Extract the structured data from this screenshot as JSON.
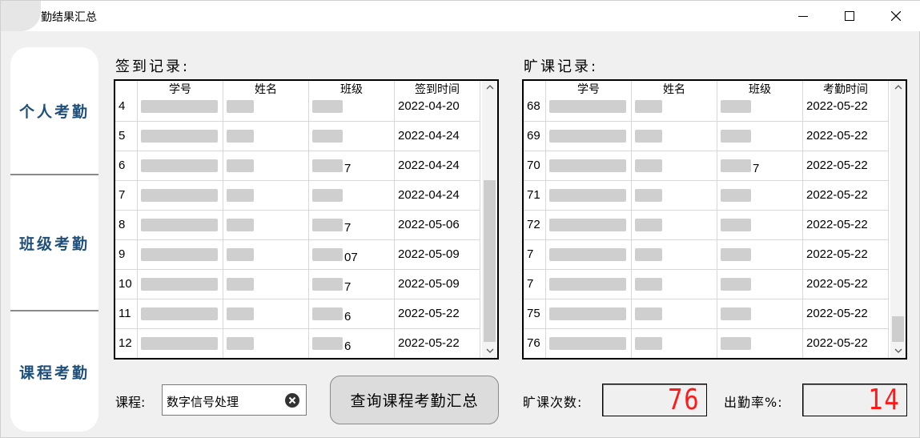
{
  "window": {
    "title": "勤结果汇总",
    "minimize_icon": "minimize-icon",
    "maximize_icon": "maximize-icon",
    "close_icon": "close-icon"
  },
  "sidebar": {
    "items": [
      {
        "label": "个人考勤"
      },
      {
        "label": "班级考勤"
      },
      {
        "label": "课程考勤"
      }
    ]
  },
  "signin": {
    "title": "签到记录:",
    "columns": [
      "学号",
      "姓名",
      "班级",
      "签到时间"
    ],
    "rows": [
      {
        "num": "4",
        "class_suffix": "",
        "date": "2022-04-20"
      },
      {
        "num": "5",
        "class_suffix": "",
        "date": "2022-04-24"
      },
      {
        "num": "6",
        "class_suffix": "7",
        "date": "2022-04-24"
      },
      {
        "num": "7",
        "class_suffix": "",
        "date": "2022-04-24"
      },
      {
        "num": "8",
        "class_suffix": "7",
        "date": "2022-05-06"
      },
      {
        "num": "9",
        "class_suffix": "07",
        "date": "2022-05-09"
      },
      {
        "num": "10",
        "class_suffix": "7",
        "date": "2022-05-09"
      },
      {
        "num": "11",
        "class_suffix": "6",
        "date": "2022-05-22"
      },
      {
        "num": "12",
        "class_suffix": "6",
        "date": "2022-05-22"
      }
    ],
    "scroll_position": 0.55
  },
  "absence": {
    "title": "旷课记录:",
    "columns": [
      "学号",
      "姓名",
      "班级",
      "考勤时间"
    ],
    "rows": [
      {
        "num": "68",
        "class_suffix": "",
        "date": "2022-05-22"
      },
      {
        "num": "69",
        "class_suffix": "",
        "date": "2022-05-22"
      },
      {
        "num": "70",
        "class_suffix": "7",
        "date": "2022-05-22"
      },
      {
        "num": "71",
        "class_suffix": "",
        "date": "2022-05-22"
      },
      {
        "num": "72",
        "class_suffix": "",
        "date": "2022-05-22"
      },
      {
        "num": "7",
        "class_suffix": "",
        "date": "2022-05-22"
      },
      {
        "num": "7",
        "class_suffix": "",
        "date": "2022-05-22"
      },
      {
        "num": "75",
        "class_suffix": "",
        "date": "2022-05-22"
      },
      {
        "num": "76",
        "class_suffix": "",
        "date": "2022-05-22"
      }
    ],
    "scroll_position": 0.95
  },
  "controls": {
    "course_label": "课程:",
    "course_value": "数字信号处理",
    "clear_icon": "clear-circle-icon",
    "query_button": "查询课程考勤汇总",
    "absence_count_label": "旷课次数:",
    "absence_count": "76",
    "attendance_rate_label": "出勤率%:",
    "attendance_rate": "14"
  },
  "colors": {
    "nav_text": "#1e4f7b",
    "lcd_digits": "#ff1a1a"
  }
}
